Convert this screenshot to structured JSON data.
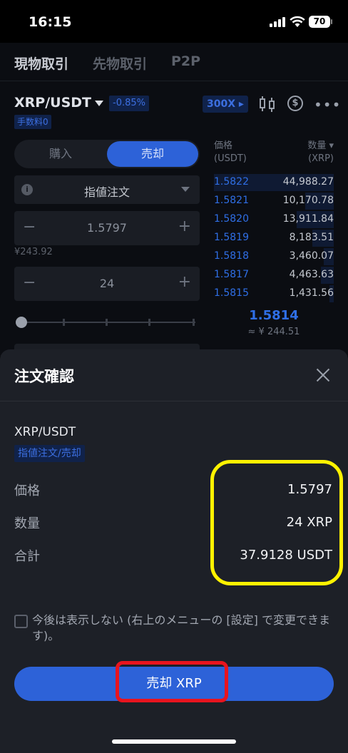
{
  "status_bar": {
    "time": "16:15",
    "battery": "70"
  },
  "top_tabs": [
    {
      "label": "現物取引",
      "color": "#c9ccd3"
    },
    {
      "label": "先物取引",
      "color": "#5c616b"
    },
    {
      "label": "P2P",
      "color": "#5c616b"
    }
  ],
  "market": {
    "pair": "XRP/USDT",
    "change": "-0.85%",
    "fee_badge": "手数料0",
    "leverage": "300X ▸",
    "icons": [
      "chart-icon",
      "dollar-icon",
      "more-icon"
    ]
  },
  "order_form": {
    "buy_label": "購入",
    "sell_label": "売却",
    "order_type": "指値注文",
    "price": "1.5797",
    "price_yen": "¥243.92",
    "quantity": "24"
  },
  "order_book": {
    "price_header": "価格\n(USDT)",
    "qty_header": "数量 ▾\n(XRP)",
    "rows": [
      {
        "price": "1.5822",
        "qty": "44,988.27",
        "depth": 1.0
      },
      {
        "price": "1.5821",
        "qty": "10,170.78",
        "depth": 0.23
      },
      {
        "price": "1.5820",
        "qty": "13,911.84",
        "depth": 0.31
      },
      {
        "price": "1.5819",
        "qty": "8,183.51",
        "depth": 0.18
      },
      {
        "price": "1.5818",
        "qty": "3,460.07",
        "depth": 0.08
      },
      {
        "price": "1.5817",
        "qty": "4,463.63",
        "depth": 0.1
      },
      {
        "price": "1.5815",
        "qty": "1,431.56",
        "depth": 0.03
      }
    ],
    "last_price": "1.5814",
    "last_price_yen": "≈ ¥ 244.51"
  },
  "modal": {
    "title": "注文確認",
    "pair": "XRP/USDT",
    "order_type": "指値注文/売却",
    "rows": [
      {
        "label": "価格",
        "value": "1.5797"
      },
      {
        "label": "数量",
        "value": "24 XRP"
      },
      {
        "label": "合計",
        "value": "37.9128 USDT"
      }
    ],
    "checkbox_text": "今後は表示しない (右上のメニューの [設定] で変更できます)。",
    "confirm_button": "売却 XRP"
  },
  "colors": {
    "accent": "#2d62d8",
    "sell_blue": "#2f6fe6",
    "highlight_yellow": "#fff200",
    "highlight_red": "#e8141e"
  }
}
